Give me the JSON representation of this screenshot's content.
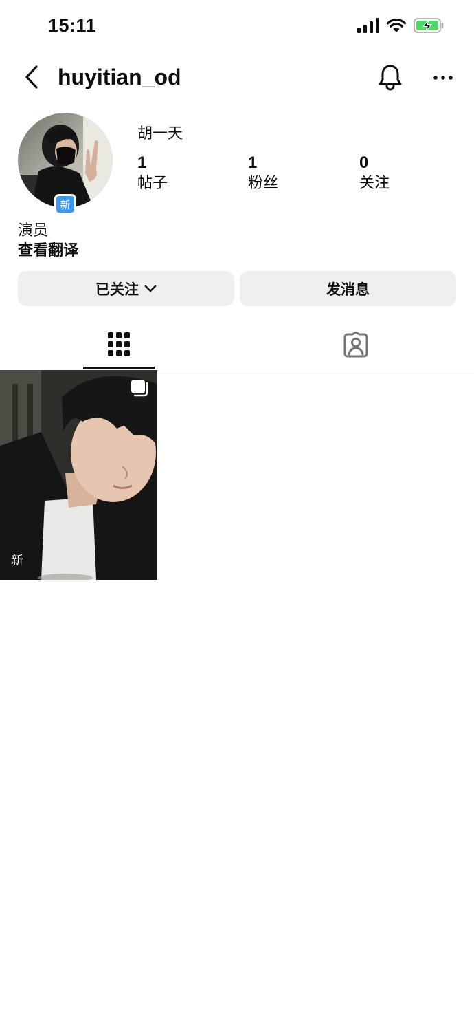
{
  "status_bar": {
    "time": "15:11"
  },
  "header": {
    "username": "huyitian_od"
  },
  "profile": {
    "display_name": "胡一天",
    "avatar_badge": "新",
    "stats": [
      {
        "value": "1",
        "label": "帖子"
      },
      {
        "value": "1",
        "label": "粉丝"
      },
      {
        "value": "0",
        "label": "关注"
      }
    ],
    "bio": "演员",
    "translate_label": "查看翻译"
  },
  "actions": {
    "following_label": "已关注",
    "message_label": "发消息"
  },
  "tabs": [
    {
      "icon": "grid-icon",
      "active": true
    },
    {
      "icon": "tagged-person-icon",
      "active": false
    }
  ],
  "posts": [
    {
      "badge": "新",
      "multi": true
    }
  ],
  "icons": {
    "back": "chevron-left-icon",
    "bell": "bell-icon",
    "more": "more-horizontal-icon",
    "dropdown": "chevron-down-icon"
  },
  "colors": {
    "badge_blue": "#3f97f0",
    "button_bg": "#efeff2",
    "battery_green": "#4cd964"
  }
}
